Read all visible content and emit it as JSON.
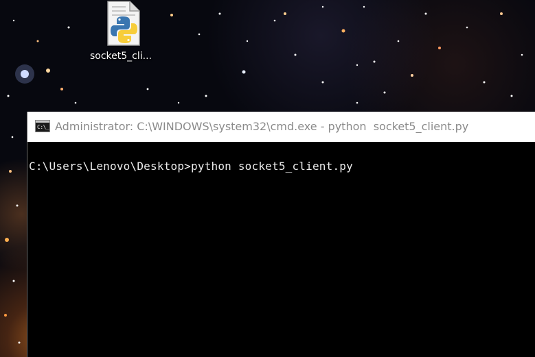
{
  "desktop": {
    "icon": {
      "label": "socket5_cli...",
      "icon_name": "python-file-icon"
    }
  },
  "cmd_window": {
    "icon_name": "cmd-icon",
    "icon_text": "C:\\_",
    "title": "Administrator: C:\\WINDOWS\\system32\\cmd.exe - python  socket5_client.py",
    "console": {
      "lines": [
        "C:\\Users\\Lenovo\\Desktop>python socket5_client.py"
      ]
    }
  },
  "colors": {
    "title_bar_bg": "#ffffff",
    "title_text": "#8a8a8a",
    "console_bg": "#000000",
    "console_text": "#ececec"
  }
}
